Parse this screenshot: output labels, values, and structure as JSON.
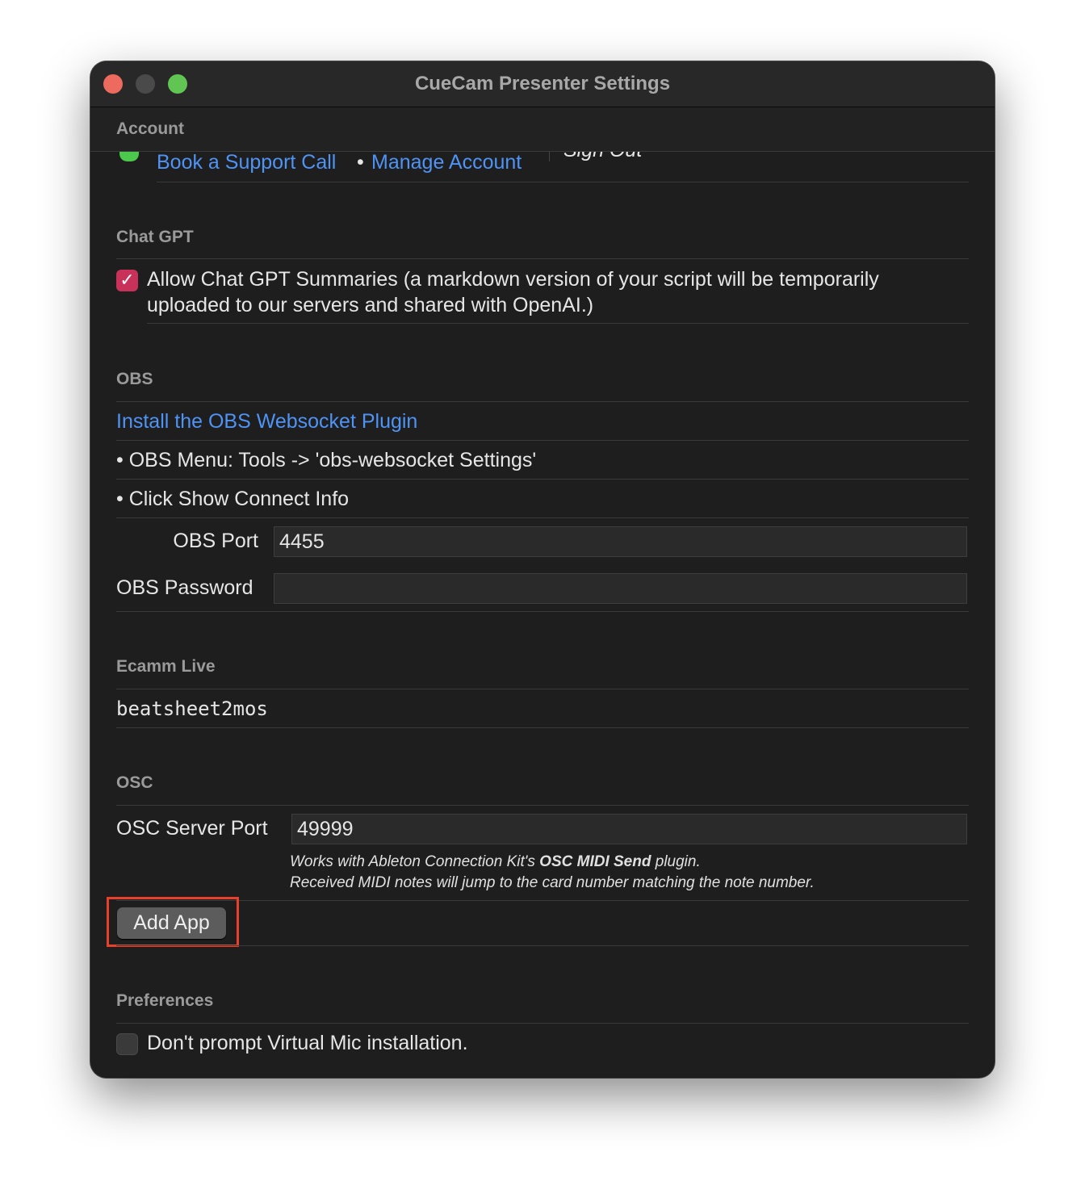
{
  "window": {
    "title": "CueCam Presenter Settings"
  },
  "account": {
    "header": "Account",
    "book_call": "Book a Support Call",
    "separator": "•",
    "manage_account": "Manage Account",
    "sign_out": "Sign Out"
  },
  "chatgpt": {
    "header": "Chat GPT",
    "checkbox_checked": true,
    "label_line1": "Allow Chat GPT Summaries (a markdown version of your script will be temporarily",
    "label_line2": "uploaded to our servers and shared with OpenAI.)"
  },
  "obs": {
    "header": "OBS",
    "install_link": "Install the OBS Websocket Plugin",
    "step1": "• OBS Menu: Tools -> 'obs-websocket Settings'",
    "step2": "• Click Show Connect Info",
    "port_label": "OBS Port",
    "port_value": "4455",
    "password_label": "OBS Password",
    "password_value": ""
  },
  "ecamm": {
    "header": "Ecamm Live",
    "value": "beatsheet2mos"
  },
  "osc": {
    "header": "OSC",
    "port_label": "OSC Server Port",
    "port_value": "49999",
    "note1_a": "Works with Ableton Connection Kit's ",
    "note1_b": "OSC MIDI Send",
    "note1_c": " plugin.",
    "note2": "Received MIDI notes will jump to the card number matching the note number.",
    "add_app": "Add App"
  },
  "preferences": {
    "header": "Preferences",
    "checkbox_checked": false,
    "label": "Don't prompt Virtual Mic installation."
  },
  "colors": {
    "accent_link": "#4f93f5",
    "checkbox": "#c8325a",
    "highlight": "#e8402a"
  }
}
